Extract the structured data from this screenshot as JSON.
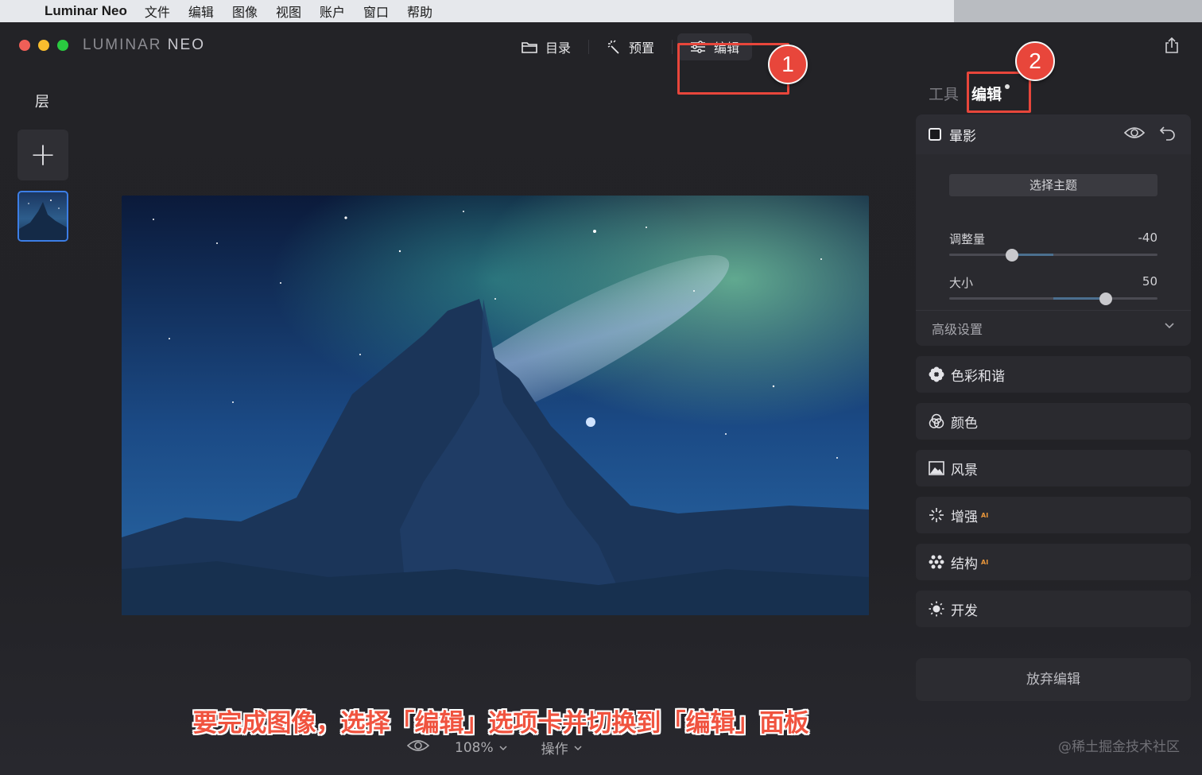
{
  "menubar": {
    "app_name": "Luminar Neo",
    "items": [
      "文件",
      "编辑",
      "图像",
      "视图",
      "账户",
      "窗口",
      "帮助"
    ]
  },
  "window": {
    "brand_light": "LUMINAR",
    "brand_bold": "NEO",
    "nav": {
      "catalog": "目录",
      "presets": "预置",
      "edit": "编辑"
    },
    "badge1": "1",
    "badge2": "2"
  },
  "layers": {
    "title": "层",
    "add_symbol": "+"
  },
  "panel": {
    "tabs": {
      "tools": "工具",
      "edit": "编辑"
    },
    "vignette": {
      "title": "暈影",
      "choose_subject": "选择主题",
      "sliders": [
        {
          "label": "调整量",
          "value": "-40",
          "level": -0.4
        },
        {
          "label": "大小",
          "value": "50",
          "level": 0.5
        }
      ],
      "advanced": "高级设置"
    },
    "tools": [
      {
        "label": "色彩和谐",
        "ai": "",
        "icon": "flower-icon"
      },
      {
        "label": "颜色",
        "ai": "",
        "icon": "color-circles-icon"
      },
      {
        "label": "风景",
        "ai": "",
        "icon": "landscape-icon"
      },
      {
        "label": "增强",
        "ai": "AI",
        "icon": "sparkle-icon"
      },
      {
        "label": "结构",
        "ai": "AI",
        "icon": "structure-dots-icon"
      },
      {
        "label": "开发",
        "ai": "",
        "icon": "sun-icon"
      }
    ],
    "discard": "放弃编辑"
  },
  "caption": "要完成图像，选择「编辑」选项卡并切换到「编辑」面板",
  "bottombar": {
    "zoom": "108%",
    "actions": "操作"
  },
  "watermark": "@稀土掘金技术社区",
  "colors": {
    "highlight": "#e8463b",
    "accent_blue": "#3c7ee6",
    "ai_orange": "#e8963b"
  }
}
